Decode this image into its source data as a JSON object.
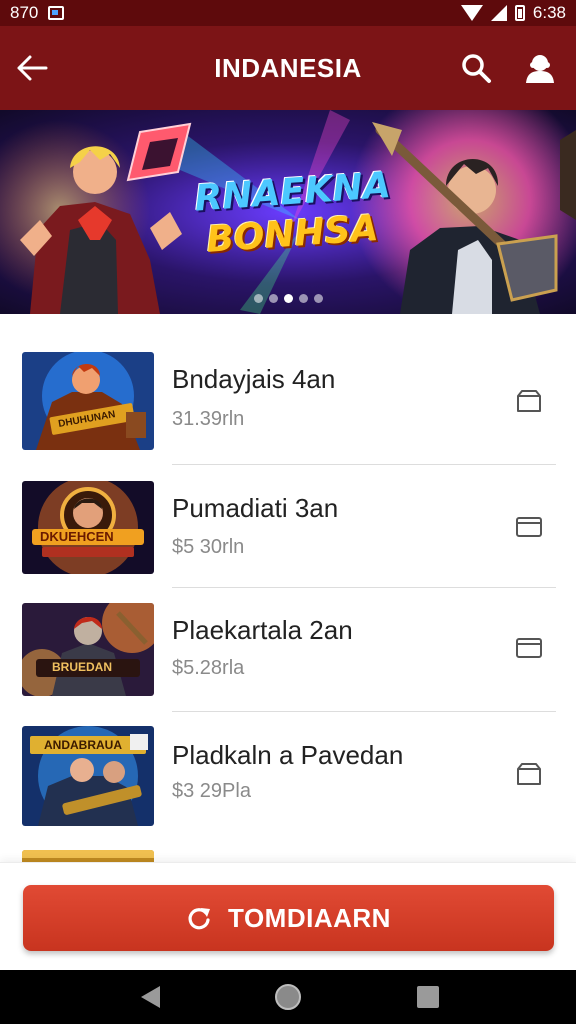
{
  "status_bar": {
    "time": "870",
    "clock": "6:38"
  },
  "app_bar": {
    "title": "INDANESIA"
  },
  "banner": {
    "title_line1": "RNAEKNA",
    "title_line2": "BONHSA",
    "dots_count": 5,
    "active_dot": 3
  },
  "list": {
    "items": [
      {
        "title": "Bndayjais 4an",
        "price": "31.39rln",
        "thumb_label": "DHUHUNAN",
        "action_icon": "box-icon"
      },
      {
        "title": "Pumadiati 3an",
        "price": "$5 30rln",
        "thumb_label": "DKUEHCEN",
        "action_icon": "card-icon"
      },
      {
        "title": "Plaekartala 2an",
        "price": "$5.28rla",
        "thumb_label": "BRUEDAN",
        "action_icon": "card-icon"
      },
      {
        "title": "Pladkaln a Pavedan",
        "price": "$3 29Pla",
        "thumb_label": "ANDABRAUA",
        "action_icon": "box-icon"
      }
    ]
  },
  "cta": {
    "label": "TOMDIAARN"
  },
  "colors": {
    "status_bar": "#5e0a0c",
    "app_bar": "#7c1416",
    "cta": "#d33c27"
  }
}
